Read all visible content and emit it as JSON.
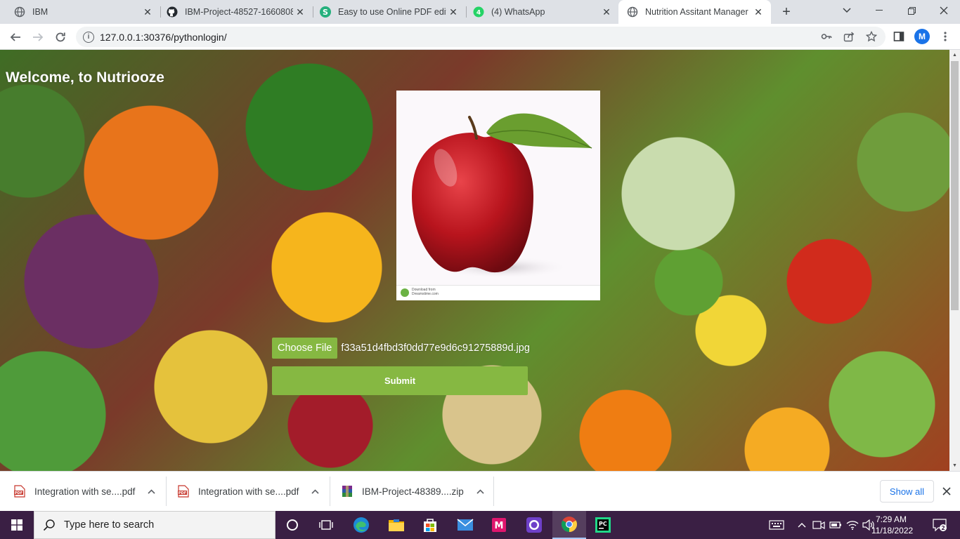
{
  "browser": {
    "tabs": [
      {
        "title": "IBM",
        "icon": "globe-icon",
        "active": false
      },
      {
        "title": "IBM-Project-48527-1660808…",
        "icon": "github-icon",
        "active": false
      },
      {
        "title": "Easy to use Online PDF edito…",
        "icon": "sejda-icon",
        "active": false
      },
      {
        "title": "(4) WhatsApp",
        "icon": "whatsapp-icon",
        "active": false
      },
      {
        "title": "Nutrition Assitant Manager",
        "icon": "globe-icon",
        "active": true
      }
    ],
    "url": "127.0.0.1:30376/pythonlogin/",
    "profile_initial": "M"
  },
  "page": {
    "heading": "Welcome, to Nutriooze",
    "preview_footer": {
      "line1": "Download from",
      "line2": "Dreamstime.com"
    },
    "choose_file_label": "Choose File",
    "file_name": "f33a51d4fbd3f0dd77e9d6c91275889d.jpg",
    "submit_label": "Submit"
  },
  "downloads": {
    "items": [
      {
        "name": "Integration with se....pdf",
        "icon": "pdf-icon"
      },
      {
        "name": "Integration with se....pdf",
        "icon": "pdf-icon"
      },
      {
        "name": "IBM-Project-48389....zip",
        "icon": "zip-icon"
      }
    ],
    "show_all_label": "Show all"
  },
  "taskbar": {
    "search_placeholder": "Type here to search",
    "time": "7:29 AM",
    "date": "11/18/2022",
    "notification_count": "2"
  },
  "colors": {
    "accent_green": "#86b842",
    "taskbar_bg": "#3a1f44",
    "chrome_blue": "#1a73e8"
  }
}
